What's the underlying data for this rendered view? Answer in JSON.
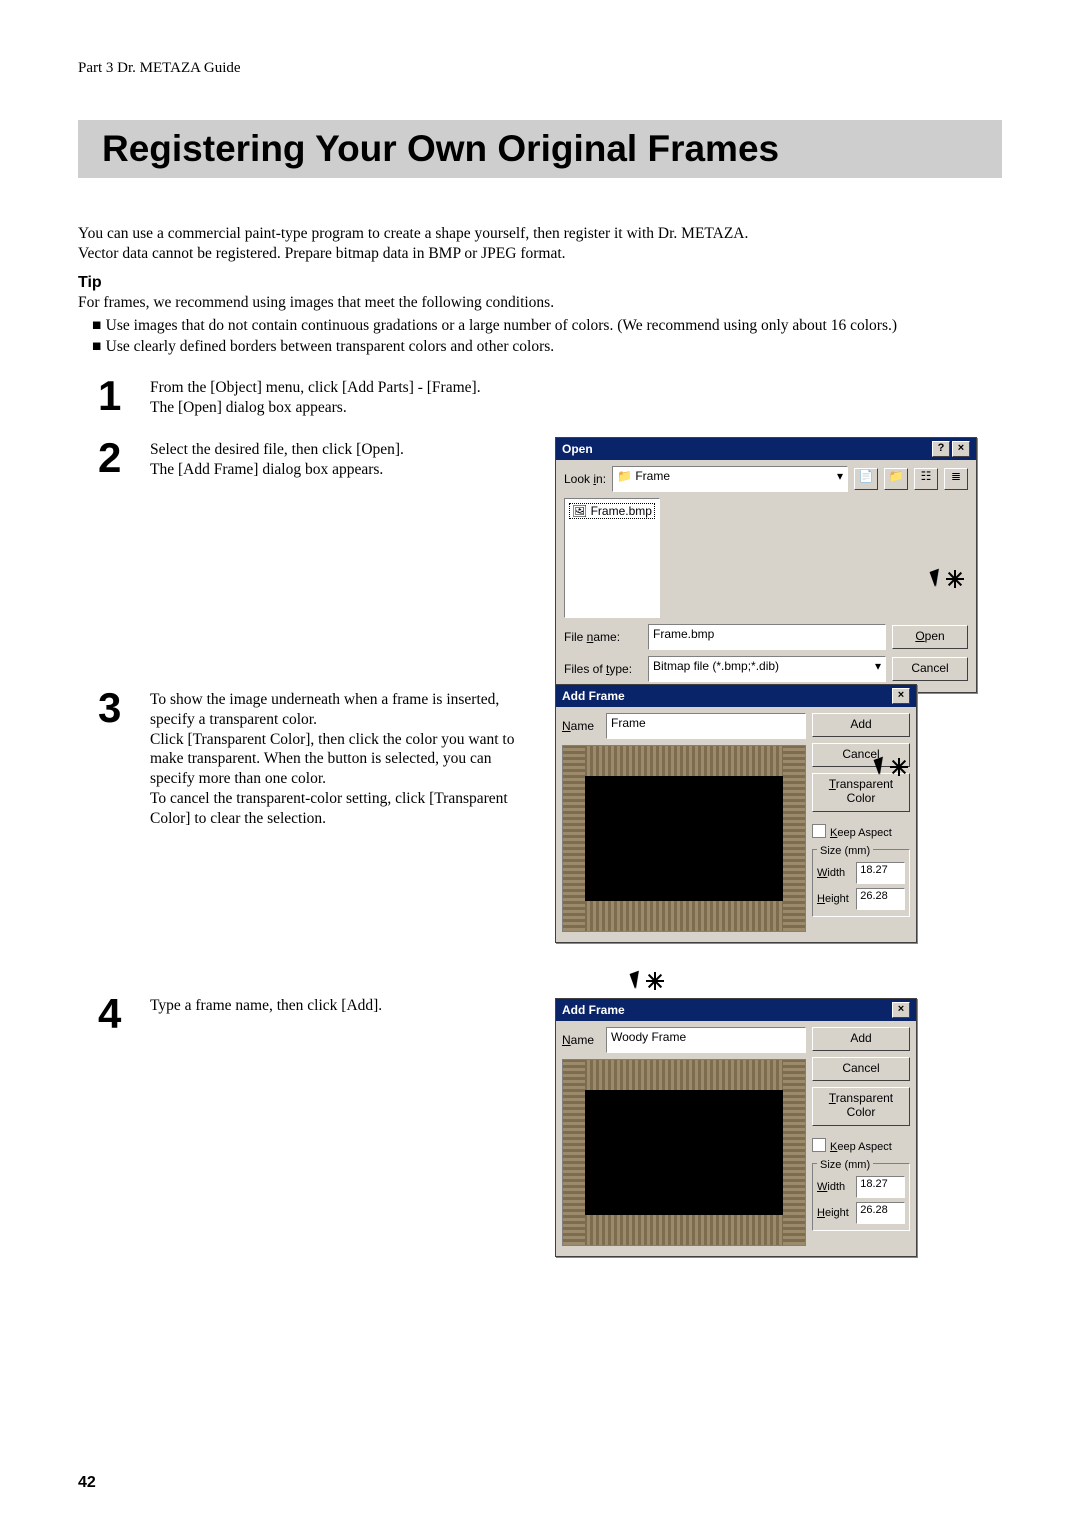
{
  "header": {
    "running": "Part 3  Dr. METAZA Guide"
  },
  "title": "Registering Your Own Original Frames",
  "intro": {
    "l1": "You can use a commercial paint-type program to create a shape yourself, then register it with Dr. METAZA.",
    "l2": "Vector data cannot be registered. Prepare bitmap data in BMP or JPEG format."
  },
  "tip": {
    "label": "Tip",
    "lead": "For frames, we recommend using images that meet the following conditions.",
    "b1": "Use images that do not contain continuous gradations or a large number of colors. (We recommend using only about 16 colors.)",
    "b2": "Use clearly defined borders between transparent colors and other colors."
  },
  "steps": {
    "s1n": "1",
    "s1a": "From the [Object] menu, click [Add Parts] - [Frame].",
    "s1b": "The [Open] dialog box appears.",
    "s2n": "2",
    "s2a": "Select the desired file, then click [Open].",
    "s2b": "The [Add Frame] dialog box appears.",
    "s3n": "3",
    "s3a": "To show the image underneath when a frame is inserted, specify a transparent color.",
    "s3b": "Click [Transparent Color], then click the color you want to make transparent. When the button is selected, you can specify more than one color.",
    "s3c": "To cancel the transparent-color setting, click [Transparent Color] to clear the selection.",
    "s4n": "4",
    "s4a": "Type a frame name, then click [Add]."
  },
  "openDlg": {
    "title": "Open",
    "help": "?",
    "close": "×",
    "lookin_lbl_pre": "Look ",
    "lookin_lbl_u": "i",
    "lookin_lbl_post": "n:",
    "lookin_val": "Frame",
    "file_item": "Frame.bmp",
    "filename_lbl_pre": "File ",
    "filename_lbl_u": "n",
    "filename_lbl_post": "ame:",
    "filename_val": "Frame.bmp",
    "filetype_lbl_pre": "Files of ",
    "filetype_lbl_u": "t",
    "filetype_lbl_post": "ype:",
    "filetype_val": "Bitmap file (*.bmp;*.dib)",
    "open_btn_u": "O",
    "open_btn_post": "pen",
    "cancel_btn": "Cancel"
  },
  "addDlg": {
    "title": "Add Frame",
    "close": "×",
    "name_lbl_u": "N",
    "name_lbl_post": "ame",
    "name1": "Frame",
    "name2": "Woody Frame",
    "add": "Add",
    "cancel": "Cancel",
    "transp_u": "T",
    "transp_post1": "ransparent",
    "transp_post2": "Color",
    "keep_u": "K",
    "keep_post": "eep Aspect",
    "size_legend": "Size (mm)",
    "width_u": "W",
    "width_post": "idth",
    "width_val": "18.27",
    "height_u": "H",
    "height_post": "eight",
    "height_val": "26.28"
  },
  "pagenum": "42"
}
